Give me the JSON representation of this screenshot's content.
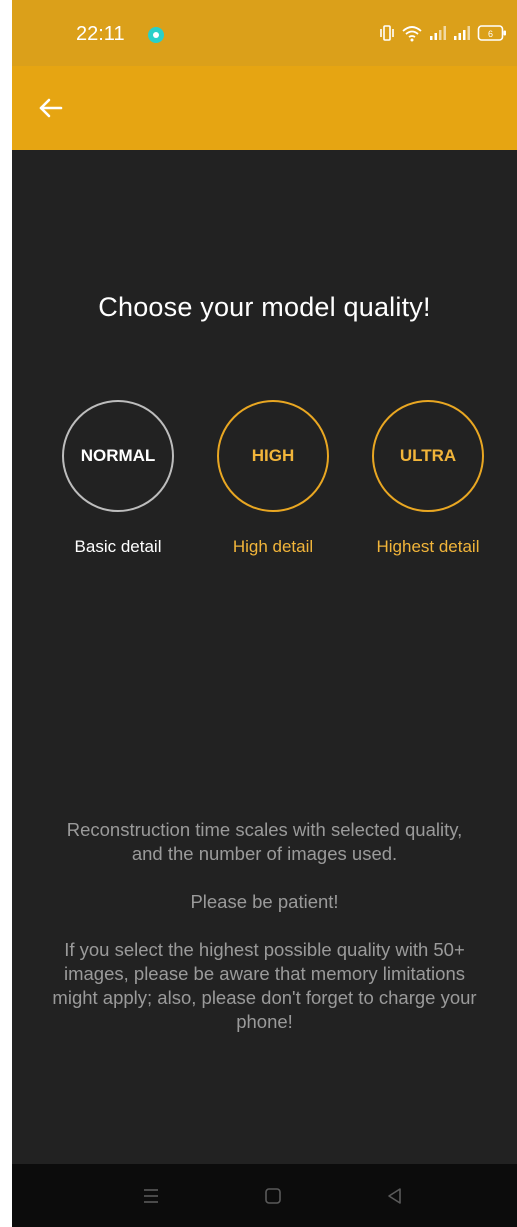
{
  "status_bar": {
    "time": "22:11",
    "battery_level": "6",
    "icons": [
      "notification-icon",
      "vibrate-icon",
      "wifi-icon",
      "signal-icon",
      "signal-icon",
      "battery-icon"
    ]
  },
  "toolbar": {
    "back_icon": "arrow-left-icon"
  },
  "heading": "Choose your model quality!",
  "options": [
    {
      "label": "NORMAL",
      "caption": "Basic detail"
    },
    {
      "label": "HIGH",
      "caption": "High detail"
    },
    {
      "label": "ULTRA",
      "caption": "Highest detail"
    }
  ],
  "info": {
    "line1": "Reconstruction time scales with selected quality, and the number of images used.",
    "line2": "Please be patient!",
    "line3": "If you select the highest possible quality with 50+ images, please be aware that memory limitations might apply; also, please don't forget to charge your phone!"
  },
  "nav_bar": {
    "icons": [
      "menu-icon",
      "home-icon",
      "back-triangle-icon"
    ]
  },
  "colors": {
    "status_bar": "#dba01a",
    "toolbar": "#e6a512",
    "background": "#222222",
    "accent": "#f2b53a",
    "normal_ring": "#bdbdbd",
    "info_text": "#9a9a9a",
    "nav_bar": "#0c0c0c"
  }
}
